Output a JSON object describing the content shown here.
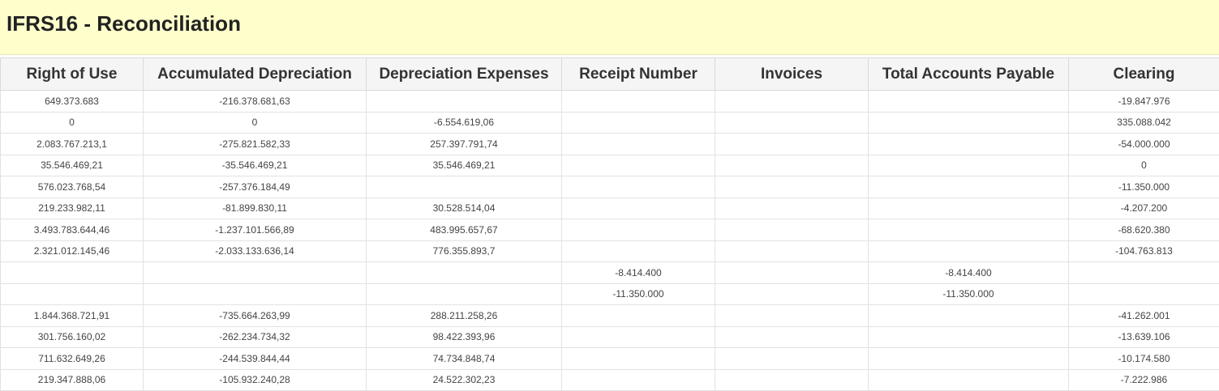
{
  "page": {
    "title": "IFRS16 - Reconciliation"
  },
  "colors": {
    "title_background": "#ffffcc",
    "header_background": "#f5f5f5",
    "border": "#d9d9d9"
  },
  "table": {
    "columns": [
      "Right of Use",
      "Accumulated Depreciation",
      "Depreciation Expenses",
      "Receipt Number",
      "Invoices",
      "Total Accounts Payable",
      "Clearing"
    ],
    "rows": [
      [
        "649.373.683",
        "-216.378.681,63",
        "",
        "",
        "",
        "",
        "-19.847.976"
      ],
      [
        "0",
        "0",
        "-6.554.619,06",
        "",
        "",
        "",
        "335.088.042"
      ],
      [
        "2.083.767.213,1",
        "-275.821.582,33",
        "257.397.791,74",
        "",
        "",
        "",
        "-54.000.000"
      ],
      [
        "35.546.469,21",
        "-35.546.469,21",
        "35.546.469,21",
        "",
        "",
        "",
        "0"
      ],
      [
        "576.023.768,54",
        "-257.376.184,49",
        "",
        "",
        "",
        "",
        "-11.350.000"
      ],
      [
        "219.233.982,11",
        "-81.899.830,11",
        "30.528.514,04",
        "",
        "",
        "",
        "-4.207.200"
      ],
      [
        "3.493.783.644,46",
        "-1.237.101.566,89",
        "483.995.657,67",
        "",
        "",
        "",
        "-68.620.380"
      ],
      [
        "2.321.012.145,46",
        "-2.033.133.636,14",
        "776.355.893,7",
        "",
        "",
        "",
        "-104.763.813"
      ],
      [
        "",
        "",
        "",
        "-8.414.400",
        "",
        "-8.414.400",
        ""
      ],
      [
        "",
        "",
        "",
        "-11.350.000",
        "",
        "-11.350.000",
        ""
      ],
      [
        "1.844.368.721,91",
        "-735.664.263,99",
        "288.211.258,26",
        "",
        "",
        "",
        "-41.262.001"
      ],
      [
        "301.756.160,02",
        "-262.234.734,32",
        "98.422.393,96",
        "",
        "",
        "",
        "-13.639.106"
      ],
      [
        "711.632.649,26",
        "-244.539.844,44",
        "74.734.848,74",
        "",
        "",
        "",
        "-10.174.580"
      ],
      [
        "219.347.888,06",
        "-105.932.240,28",
        "24.522.302,23",
        "",
        "",
        "",
        "-7.222.986"
      ]
    ]
  }
}
